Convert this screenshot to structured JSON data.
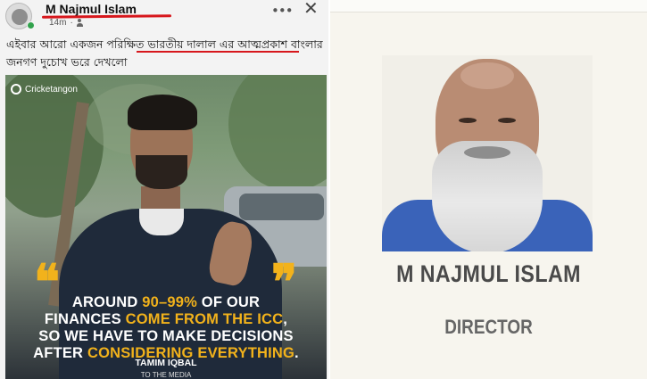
{
  "post": {
    "author_name": "M Najmul Islam",
    "time": "14m",
    "more_icon": "more-dots-icon",
    "close_icon": "close-icon",
    "privacy_icon": "friends-icon",
    "text": "এইবার আরো একজন পরিক্ষিত ভারতীয় দালাল এর আত্মপ্রকাশ বাংলার জনগণ দুচোখ ভরে দেখলো"
  },
  "post_image": {
    "watermark": "Cricketangon",
    "quote_open": "❝",
    "quote_close": "❞",
    "quote_line1_pre": "AROUND ",
    "quote_line1_hl": "90–99%",
    "quote_line1_post": " OF OUR",
    "quote_line2_pre": "FINANCES ",
    "quote_line2_hl": "COME FROM THE ICC",
    "quote_line2_post": ",",
    "quote_line3": "SO WE HAVE TO MAKE DECISIONS",
    "quote_line4_pre": "AFTER ",
    "quote_line4_hl": "CONSIDERING EVERYTHING",
    "quote_line4_post": ".",
    "quote_author": "TAMIM IQBAL",
    "quote_source": "TO THE MEDIA"
  },
  "director_card": {
    "name": "M NAJMUL ISLAM",
    "title": "DIRECTOR"
  },
  "colors": {
    "highlight_yellow": "#f2b21b",
    "annotation_red": "#d7171c",
    "online_green": "#31a24c"
  }
}
